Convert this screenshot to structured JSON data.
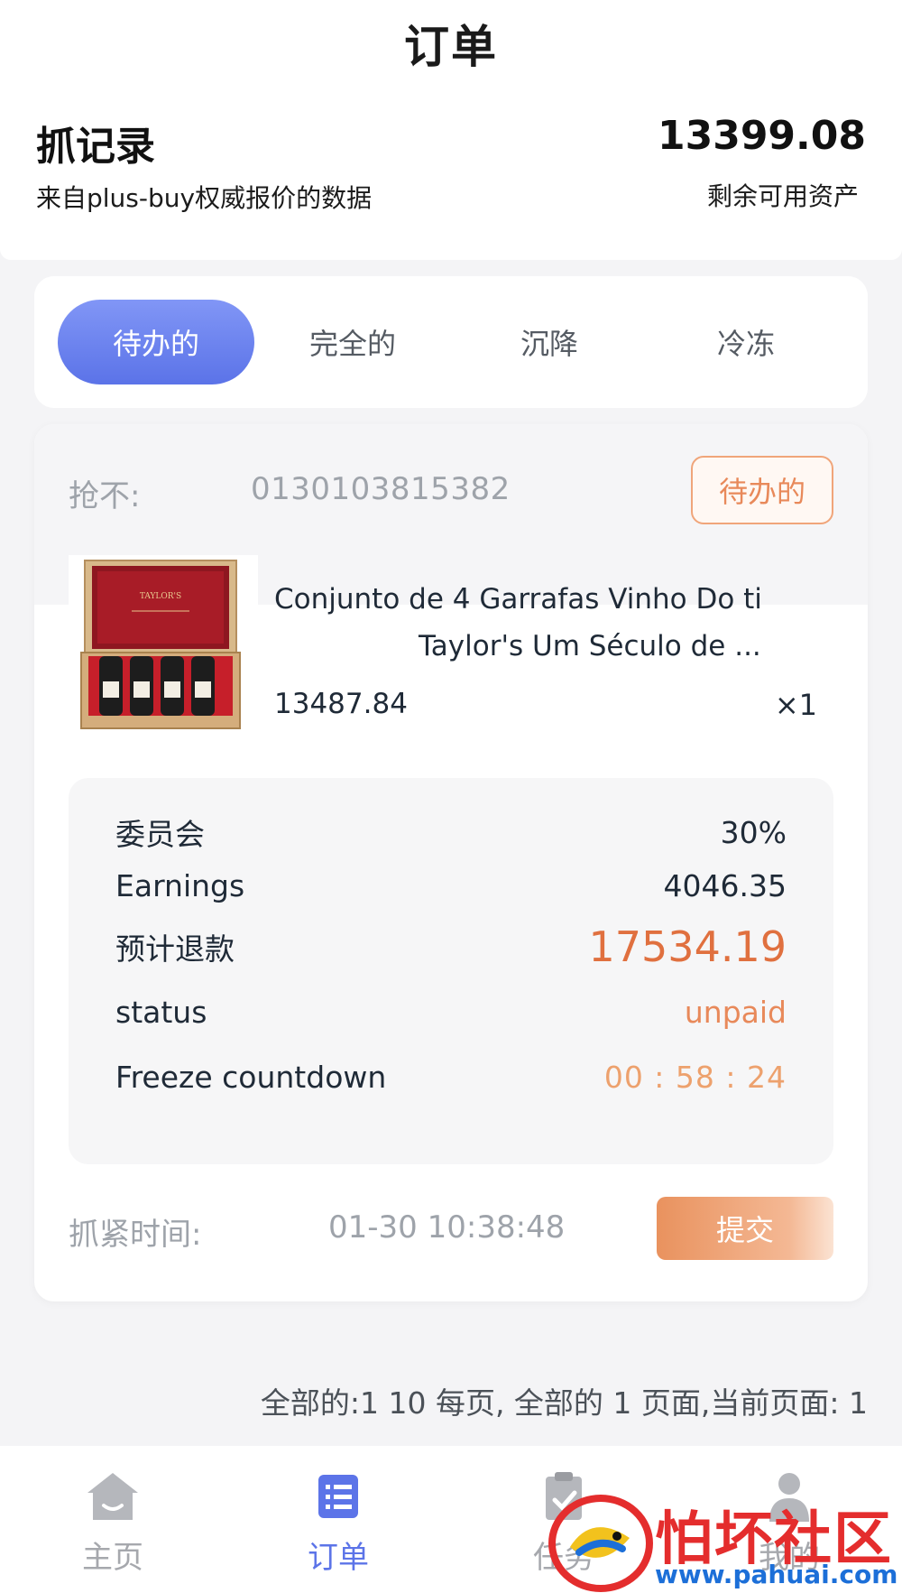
{
  "header": {
    "title": "订单",
    "left_title": "抓记录",
    "left_subtitle": "来自plus-buy权威报价的数据",
    "balance": "13399.08",
    "balance_label": "剩余可用资产"
  },
  "tabs": [
    {
      "label": "待办的",
      "active": true
    },
    {
      "label": "完全的",
      "active": false
    },
    {
      "label": "沉降",
      "active": false
    },
    {
      "label": "冷冻",
      "active": false
    }
  ],
  "order": {
    "number_label": "抢不:",
    "number": "0130103815382",
    "status_badge": "待办的",
    "product": {
      "name_line1": "Conjunto de 4 Garrafas Vinho Do ti",
      "name_line2": "Taylor's Um Século de ...",
      "price": "13487.84",
      "quantity": "×1",
      "image_brand_text": "TAYLOR'S"
    },
    "details": {
      "commission_label": "委员会",
      "commission_value": "30%",
      "earnings_label": "Earnings",
      "earnings_value": "4046.35",
      "refund_label": "预计退款",
      "refund_value": "17534.19",
      "status_label": "status",
      "status_value": "unpaid",
      "countdown_label": "Freeze countdown",
      "countdown_value": "00 : 58 : 24"
    },
    "grab_time_label": "抓紧时间:",
    "grab_time": "01-30 10:38:48",
    "submit_label": "提交"
  },
  "pagination": "全部的:1 10 每页, 全部的 1 页面,当前页面: 1",
  "nav": [
    {
      "label": "主页",
      "icon": "home-icon",
      "active": false
    },
    {
      "label": "订单",
      "icon": "orders-list-icon",
      "active": true
    },
    {
      "label": "任务",
      "icon": "clipboard-check-icon",
      "active": false
    },
    {
      "label": "我的",
      "icon": "user-icon",
      "active": false
    }
  ],
  "watermark": {
    "text": "怕坏社区",
    "url": "www.pahuai.com"
  },
  "colors": {
    "accent_blue": "#5c74e8",
    "accent_orange": "#e8895a",
    "refund_red": "#e0703f"
  }
}
